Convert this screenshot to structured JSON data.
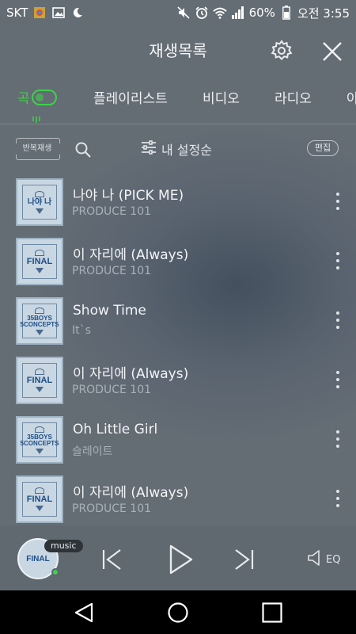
{
  "status_bar": {
    "carrier": "SKT",
    "battery": "60%",
    "time": "오전 3:55",
    "icons": [
      "gallery-icon",
      "image-icon",
      "moon-icon",
      "mute-icon",
      "alarm-icon",
      "wifi-icon",
      "signal-icon",
      "battery-icon"
    ]
  },
  "header": {
    "title": "재생목록",
    "settings_icon": "gear-icon",
    "close_icon": "close-icon"
  },
  "tabs": [
    {
      "label": "곡",
      "active": true
    },
    {
      "label": "플레이리스트",
      "active": false
    },
    {
      "label": "비디오",
      "active": false
    },
    {
      "label": "라디오",
      "active": false
    },
    {
      "label": "아",
      "active": false
    }
  ],
  "toolbar": {
    "repeat_label": "반복재생",
    "sort_label": "내 설정순",
    "edit_label": "편집"
  },
  "songs": [
    {
      "title": "나야 나 (PICK ME)",
      "artist": "PRODUCE 101",
      "art": "나야 나"
    },
    {
      "title": "이 자리에 (Always)",
      "artist": "PRODUCE 101",
      "art": "FINAL"
    },
    {
      "title": "Show Time",
      "artist": "It`s",
      "art": "35BOYS 5CONCEPTS"
    },
    {
      "title": "이 자리에 (Always)",
      "artist": "PRODUCE 101",
      "art": "FINAL"
    },
    {
      "title": "Oh Little Girl",
      "artist": "슬레이트",
      "art": "35BOYS 5CONCEPTS"
    },
    {
      "title": "이 자리에 (Always)",
      "artist": "PRODUCE 101",
      "art": "FINAL"
    }
  ],
  "player": {
    "badge": "music",
    "art": "FINAL",
    "eq_label": "EQ"
  },
  "colors": {
    "accent": "#3fd14a",
    "background": "#5a6470"
  }
}
